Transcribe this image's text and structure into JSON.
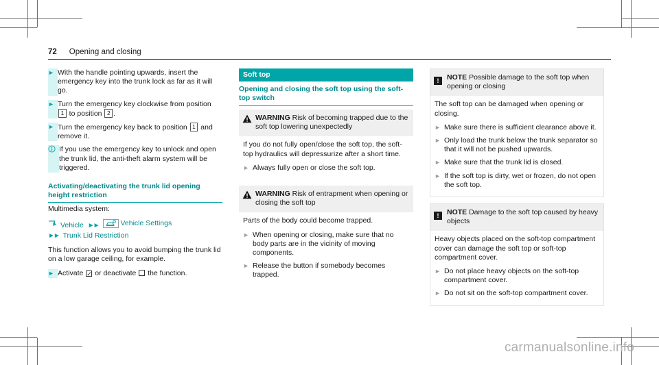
{
  "header": {
    "page_number": "72",
    "title": "Opening and closing"
  },
  "watermark": "carmanualsonline.info",
  "left_column": {
    "steps": [
      {
        "icon": "triangle-bullet-icon",
        "text_parts": [
          "With the handle pointing upwards, insert the emergency key into the trunk lock as far as it will go."
        ]
      },
      {
        "icon": "triangle-bullet-icon",
        "text_parts": [
          "Turn the emergency key clockwise from position ",
          "1",
          " to position ",
          "2",
          "."
        ]
      },
      {
        "icon": "triangle-bullet-icon",
        "text_parts": [
          "Turn the emergency key back to position ",
          "1",
          " and remove it."
        ]
      }
    ],
    "step1_text": "With the handle pointing upwards, insert the emergency key into the trunk lock as far as it will go.",
    "step2_pre": "Turn the emergency key clockwise from position",
    "step2_num1": "1",
    "step2_mid": "to position",
    "step2_num2": "2",
    "step2_post": ".",
    "step3_pre": "Turn the emergency key back to position",
    "step3_num1": "1",
    "step3_post": "and remove it.",
    "info_note": "If you use the emergency key to unlock and open the trunk lid, the anti-theft alarm system will be triggered.",
    "section_heading": "Activating/deactivating the trunk lid opening height restriction",
    "multimedia_label": "Multimedia system:",
    "nav_path": {
      "item1": "Vehicle",
      "item2": "Vehicle Settings",
      "item3": "Trunk Lid Restriction"
    },
    "function_desc": "This function allows you to avoid bumping the trunk lid on a low garage ceiling, for example.",
    "activate_pre": "Activate",
    "activate_checked": "✓",
    "activate_mid": "or deactivate",
    "activate_post": "the function."
  },
  "middle_column": {
    "section_bar": "Soft top",
    "section_heading": "Opening and closing the soft top using the soft-top switch",
    "warning1": {
      "icon": "warning-triangle-icon",
      "label": "WARNING",
      "title": "Risk of becoming trapped due to the soft top lowering unexpectedly",
      "body": "If you do not fully open/close the soft top, the soft-top hydraulics will depressurize after a short time.",
      "bullets": [
        "Always fully open or close the soft top."
      ]
    },
    "warning2": {
      "icon": "warning-triangle-icon",
      "label": "WARNING",
      "title": "Risk of entrapment when opening or closing the soft top",
      "body": "Parts of the body could become trapped.",
      "bullets": [
        "When opening or closing, make sure that no body parts are in the vicinity of moving components.",
        "Release the button if somebody becomes trapped."
      ]
    }
  },
  "right_column": {
    "note1": {
      "icon": "note-square-icon",
      "label": "NOTE",
      "title": "Possible damage to the soft top when opening or closing",
      "body": "The soft top can be damaged when opening or closing.",
      "bullets": [
        "Make sure there is sufficient clearance above it.",
        "Only load the trunk below the trunk separator so that it will not be pushed upwards.",
        "Make sure that the trunk lid is closed.",
        "If the soft top is dirty, wet or frozen, do not open the soft top."
      ]
    },
    "note2": {
      "icon": "note-square-icon",
      "label": "NOTE",
      "title": "Damage to the soft top caused by heavy objects",
      "body": "Heavy objects placed on the soft-top compartment cover can damage the soft top or soft-top compartment cover.",
      "bullets": [
        "Do not place heavy objects on the soft-top compartment cover.",
        "Do not sit on the soft-top compartment cover."
      ]
    }
  },
  "colors": {
    "teal": "#00a5a8",
    "teal_dark": "#00898c",
    "bullet_grey": "#9aa0a0",
    "warn_bg": "#efefef"
  }
}
